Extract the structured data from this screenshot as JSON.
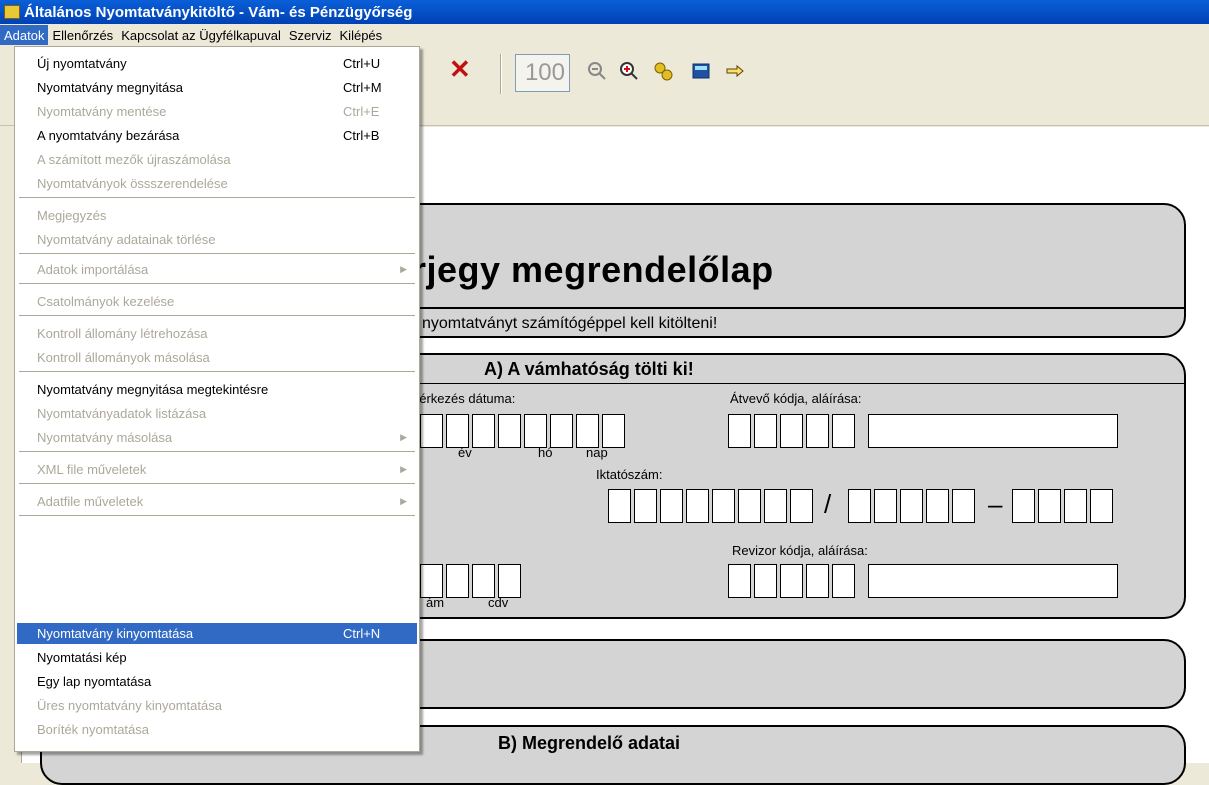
{
  "window": {
    "title": "Általános Nyomtatványkitöltő - Vám- és Pénzügyőrség"
  },
  "menubar": [
    "Adatok",
    "Ellenőrzés",
    "Kapcsolat az Ügyfélkapuval",
    "Szerviz",
    "Kilépés"
  ],
  "toolbar": {
    "zoom_value": "100"
  },
  "dropdown": {
    "items": [
      {
        "label": "Új nyomtatvány",
        "shortcut": "Ctrl+U"
      },
      {
        "label": "Nyomtatvány megnyitása",
        "shortcut": "Ctrl+M"
      },
      {
        "label": "Nyomtatvány mentése",
        "shortcut": "Ctrl+E"
      },
      {
        "label": "A nyomtatvány bezárása",
        "shortcut": "Ctrl+B"
      },
      {
        "label": "A számított mezők újraszámolása",
        "shortcut": ""
      },
      {
        "label": "Nyomtatványok össszerendelése",
        "shortcut": ""
      },
      {
        "label": "Megjegyzés",
        "shortcut": ""
      },
      {
        "label": "Nyomtatvány adatainak törlése",
        "shortcut": ""
      },
      {
        "label": "Adatok importálása",
        "shortcut": ""
      },
      {
        "label": "Csatolmányok kezelése",
        "shortcut": ""
      },
      {
        "label": "Kontroll állomány létrehozása",
        "shortcut": ""
      },
      {
        "label": "Kontroll állományok másolása",
        "shortcut": ""
      },
      {
        "label": "Nyomtatvány megnyitása megtekintésre",
        "shortcut": ""
      },
      {
        "label": "Nyomtatványadatok listázása",
        "shortcut": ""
      },
      {
        "label": "Nyomtatvány másolása",
        "shortcut": ""
      },
      {
        "label": "XML file műveletek",
        "shortcut": ""
      },
      {
        "label": "Adatfile műveletek",
        "shortcut": ""
      },
      {
        "label": "Nyomtatvány kinyomtatása",
        "shortcut": "Ctrl+N"
      },
      {
        "label": "Nyomtatási kép",
        "shortcut": ""
      },
      {
        "label": "Egy lap nyomtatása",
        "shortcut": ""
      },
      {
        "label": "Üres nyomtatvány kinyomtatása",
        "shortcut": ""
      },
      {
        "label": "Boríték nyomtatása",
        "shortcut": ""
      }
    ]
  },
  "form": {
    "title": "rjegy megrendelőlap",
    "subtitle": "nyomtatványt számítógéppel  kell kitölteni!",
    "section_a": "A) A vámhatóság tölti ki!",
    "received_date_label": "eérkezés dátuma:",
    "received_by_label": "Átvevő kódja, aláírása:",
    "year_label": "év",
    "month_label": "hó",
    "day_label": "nap",
    "iktatoszam_label": "Iktatószám:",
    "revizor_label": "Revizor kódja, aláírása:",
    "szam_label": "ám",
    "cdv_label": "cdv",
    "section_b": "B) Megrendelő adatai"
  },
  "colors": {
    "titlebar": "#0a5fd8",
    "highlight": "#316ac5",
    "panel": "#d4d4d4"
  }
}
